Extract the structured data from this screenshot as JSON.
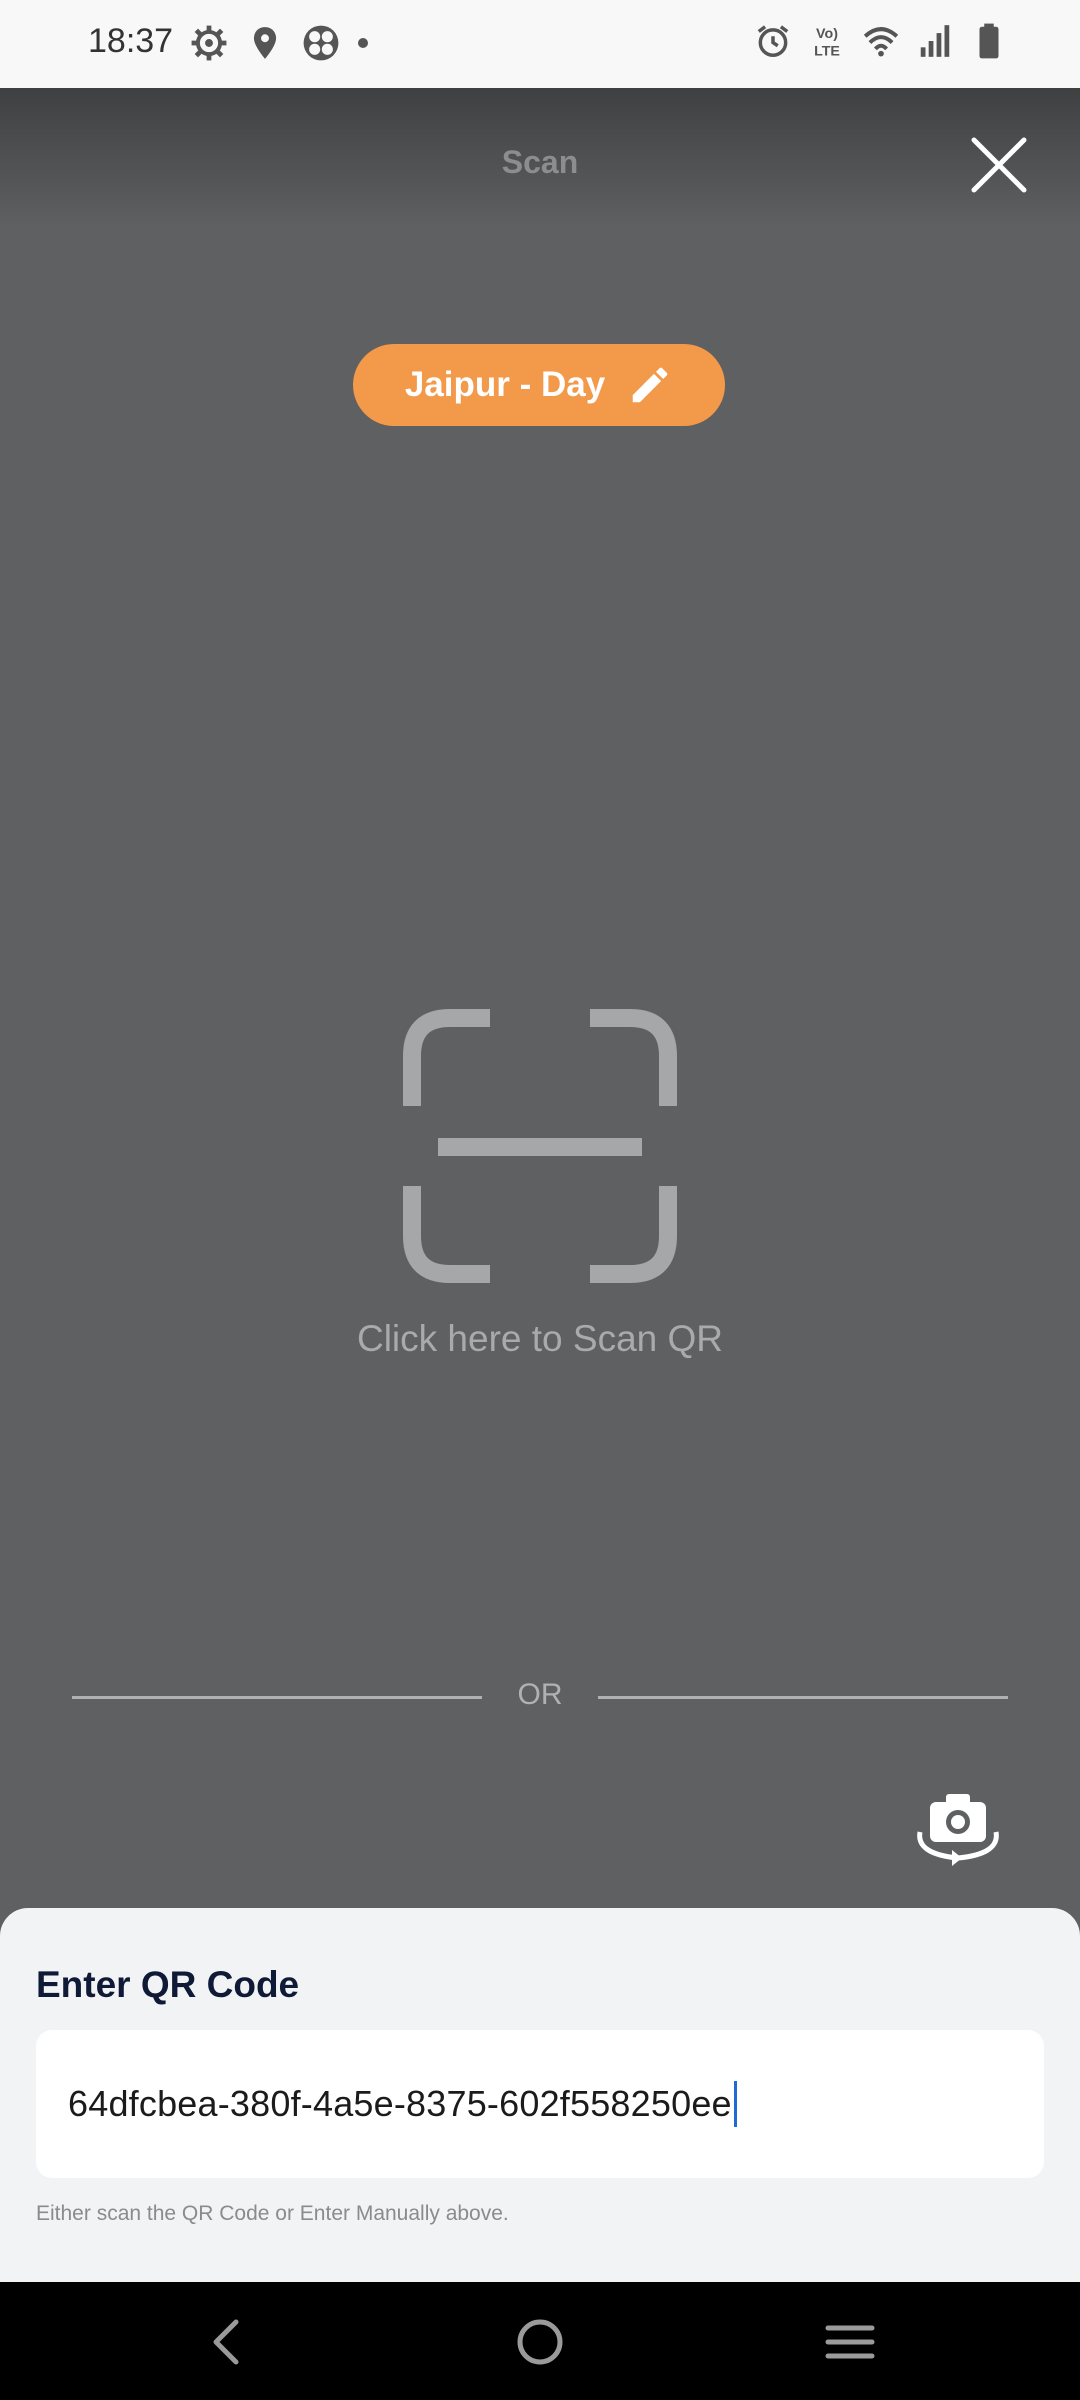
{
  "status_bar": {
    "time": "18:37",
    "left_icons": [
      "settings-gear-icon",
      "location-drop-icon",
      "fan-icon",
      "notification-dot-icon"
    ],
    "right_icons": [
      "alarm-icon",
      "volte-icon",
      "wifi-icon",
      "signal-icon",
      "battery-icon"
    ],
    "volte_label": "Vo) LTE"
  },
  "header": {
    "title": "Scan",
    "close_icon": "close-icon"
  },
  "location": {
    "label": "Jaipur - Day",
    "edit_icon": "pencil-icon",
    "color": "#f2994a"
  },
  "scanner": {
    "hint": "Click here to Scan QR",
    "frame_icon": "qr-scan-frame-icon",
    "divider_text": "OR",
    "camera_switch_icon": "camera-switch-icon"
  },
  "manual_entry": {
    "title": "Enter QR Code",
    "value": "64dfcbea-380f-4a5e-8375-602f558250ee",
    "hint": "Either scan the QR Code or Enter Manually above."
  },
  "nav_bar": {
    "back_icon": "back-icon",
    "home_icon": "home-icon",
    "recents_icon": "recents-icon"
  }
}
